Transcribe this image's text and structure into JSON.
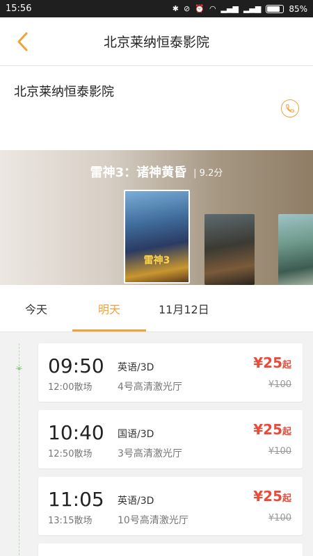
{
  "status_bar": {
    "time": "15:56",
    "battery": "85%"
  },
  "nav": {
    "title": "北京莱纳恒泰影院"
  },
  "cinema": {
    "name": "北京莱纳恒泰影院"
  },
  "movie": {
    "title": "雷神3：诸神黄昏",
    "score": "| 9.2分",
    "poster_text": "雷神3"
  },
  "tabs": [
    {
      "label": "今天"
    },
    {
      "label": "明天"
    },
    {
      "label": "11月12日"
    }
  ],
  "showtimes": [
    {
      "start": "09:50",
      "end": "12:00散场",
      "lang": "英语/3D",
      "hall": "4号高清激光厅",
      "price": "¥25",
      "suffix": "起",
      "original": "¥100"
    },
    {
      "start": "10:40",
      "end": "12:50散场",
      "lang": "国语/3D",
      "hall": "3号高清激光厅",
      "price": "¥25",
      "suffix": "起",
      "original": "¥100"
    },
    {
      "start": "11:05",
      "end": "13:15散场",
      "lang": "英语/3D",
      "hall": "10号高清激光厅",
      "price": "¥25",
      "suffix": "起",
      "original": "¥100"
    }
  ],
  "colors": {
    "accent": "#f0a23a",
    "price": "#e84b3a",
    "timeline": "#8fcf86"
  }
}
